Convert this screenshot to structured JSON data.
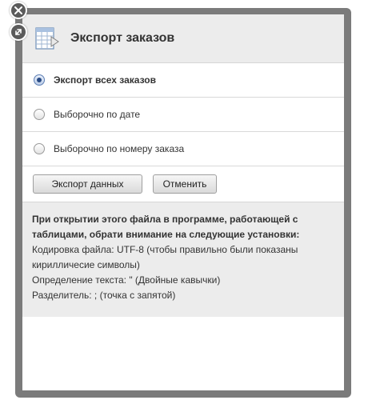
{
  "dialog": {
    "title": "Экспорт заказов",
    "options": [
      {
        "label": "Экспорт всех заказов",
        "selected": true
      },
      {
        "label": "Выборочно по дате",
        "selected": false
      },
      {
        "label": "Выборочно по номеру заказа",
        "selected": false
      }
    ],
    "buttons": {
      "export": "Экспорт данных",
      "cancel": "Отменить"
    },
    "info": {
      "heading": "При открытии этого файла в программе, работающей с таблицами, обрати внимание на следующие установки:",
      "lines": [
        "Кодировка файла: UTF-8 (чтобы правильно были показаны кирилличесие символы)",
        "Определение текста: \" (Двойные кавычки)",
        "Разделитель: ; (точка с запятой)"
      ]
    }
  },
  "window_controls": {
    "close_icon": "close-icon",
    "resize_icon": "resize-icon"
  },
  "colors": {
    "frame": "#7b7b7b",
    "header_bg": "#ececec",
    "radio_selected": "#2a4c85"
  }
}
